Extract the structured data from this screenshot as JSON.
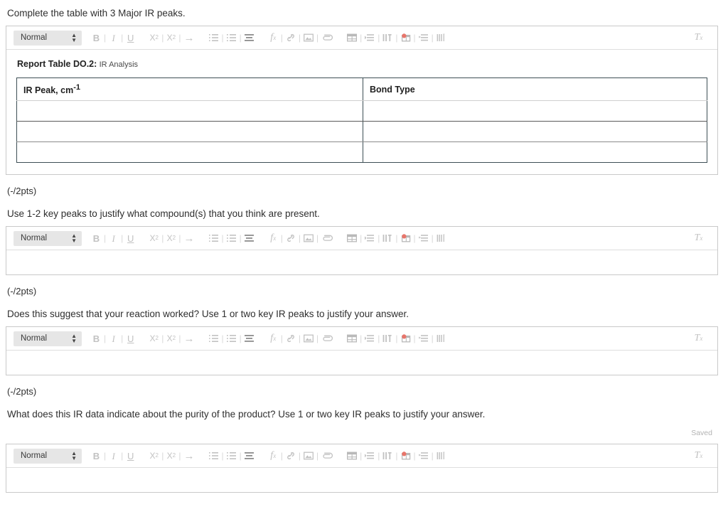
{
  "questions": [
    {
      "prompt": "Complete the table with 3 Major IR peaks.",
      "points": "(-/2pts)"
    },
    {
      "prompt": "Use 1-2 key peaks to justify what compound(s) that you think are present.",
      "points": "(-/2pts)"
    },
    {
      "prompt": "Does this suggest that your reaction worked? Use 1 or two key IR peaks to justify your answer.",
      "points": "(-/2pts)"
    },
    {
      "prompt": "What does this IR data indicate about the purity of the product? Use 1 or two key IR peaks to justify your answer."
    }
  ],
  "toolbar": {
    "style_value": "Normal",
    "bold_label": "B",
    "italic_label": "I",
    "underline_label": "U",
    "subscript_label": "X",
    "subscript_index": "2",
    "superscript_label": "X",
    "superscript_index": "2",
    "indent_label": "→",
    "formula_label": "f",
    "formula_index": "x",
    "clear_format_label": "T",
    "clear_format_index": "x",
    "separator": "|"
  },
  "report_table": {
    "caption_bold": "Report Table DO.2:",
    "caption_rest": "IR Analysis",
    "headers": [
      {
        "text": "IR Peak, cm",
        "sup": "-1"
      },
      {
        "text": "Bond Type",
        "sup": ""
      }
    ],
    "rows": [
      [
        "",
        ""
      ],
      [
        "",
        ""
      ],
      [
        "",
        ""
      ]
    ]
  },
  "status": {
    "saved_label": "Saved"
  },
  "colors": {
    "accent_red": "#e8756b",
    "table_border": "#3d4f55",
    "icon_gray": "#c2c2c2",
    "frame_gray": "#c9c9c9"
  }
}
